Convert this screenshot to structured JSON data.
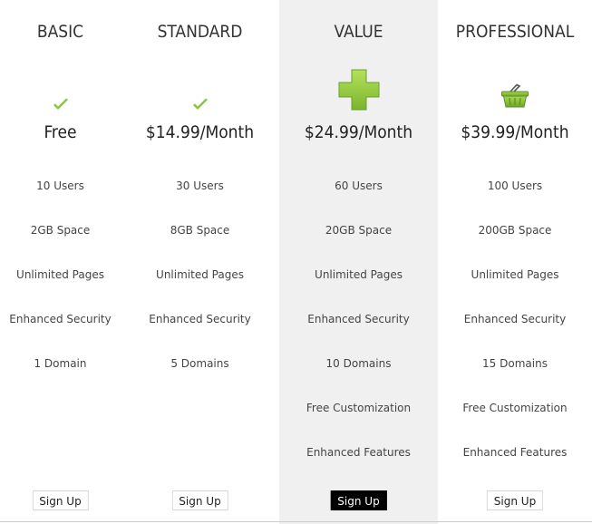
{
  "plans": [
    {
      "name": "BASIC",
      "icon": "checkmark-icon",
      "price": "Free",
      "features": [
        "10 Users",
        "2GB Space",
        "Unlimited Pages",
        "Enhanced Security",
        "1 Domain"
      ],
      "button": "Sign Up"
    },
    {
      "name": "STANDARD",
      "icon": "checkmark-icon",
      "price": "$14.99/Month",
      "features": [
        "30 Users",
        "8GB Space",
        "Unlimited Pages",
        "Enhanced Security",
        "5 Domains"
      ],
      "button": "Sign Up"
    },
    {
      "name": "VALUE",
      "icon": "plus-icon",
      "price": "$24.99/Month",
      "features": [
        "60 Users",
        "20GB Space",
        "Unlimited Pages",
        "Enhanced Security",
        "10 Domains",
        "Free Customization",
        "Enhanced Features"
      ],
      "button": "Sign Up",
      "highlighted": true
    },
    {
      "name": "PROFESSIONAL",
      "icon": "basket-icon",
      "price": "$39.99/Month",
      "features": [
        "100 Users",
        "200GB Space",
        "Unlimited Pages",
        "Enhanced Security",
        "15 Domains",
        "Free Customization",
        "Enhanced Features"
      ],
      "button": "Sign Up"
    }
  ],
  "colors": {
    "highlight_column": "#f0f0f0",
    "icon_green": "#8cc63f",
    "dark_button": "#000000"
  }
}
